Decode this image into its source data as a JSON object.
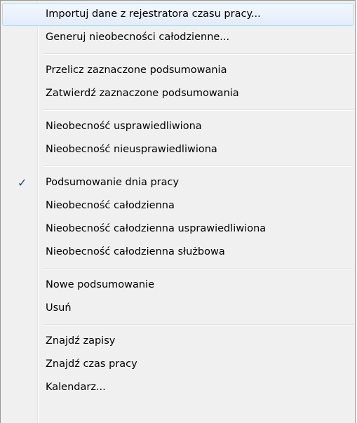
{
  "menu": {
    "groups": [
      {
        "items": [
          {
            "label": "Importuj dane z rejestratora czasu pracy...",
            "highlighted": true
          },
          {
            "label": "Generuj nieobecności całodzienne..."
          }
        ]
      },
      {
        "items": [
          {
            "label": "Przelicz zaznaczone podsumowania"
          },
          {
            "label": "Zatwierdź zaznaczone podsumowania"
          }
        ]
      },
      {
        "items": [
          {
            "label": "Nieobecność usprawiedliwiona"
          },
          {
            "label": "Nieobecność nieusprawiedliwiona"
          }
        ]
      },
      {
        "items": [
          {
            "label": "Podsumowanie dnia pracy",
            "checked": true
          },
          {
            "label": "Nieobecność całodzienna"
          },
          {
            "label": "Nieobecność całodzienna usprawiedliwiona"
          },
          {
            "label": "Nieobecność całodzienna służbowa"
          }
        ]
      },
      {
        "items": [
          {
            "label": "Nowe podsumowanie"
          },
          {
            "label": "Usuń"
          }
        ]
      },
      {
        "items": [
          {
            "label": "Znajdź zapisy"
          },
          {
            "label": "Znajdź czas pracy"
          },
          {
            "label": "Kalendarz..."
          }
        ]
      }
    ],
    "check_glyph": "✓",
    "colors": {
      "background": "#f0f0f0",
      "highlight": "#e2edfb",
      "highlight_border": "#b8d6fb",
      "check": "#1e3e8a"
    }
  }
}
